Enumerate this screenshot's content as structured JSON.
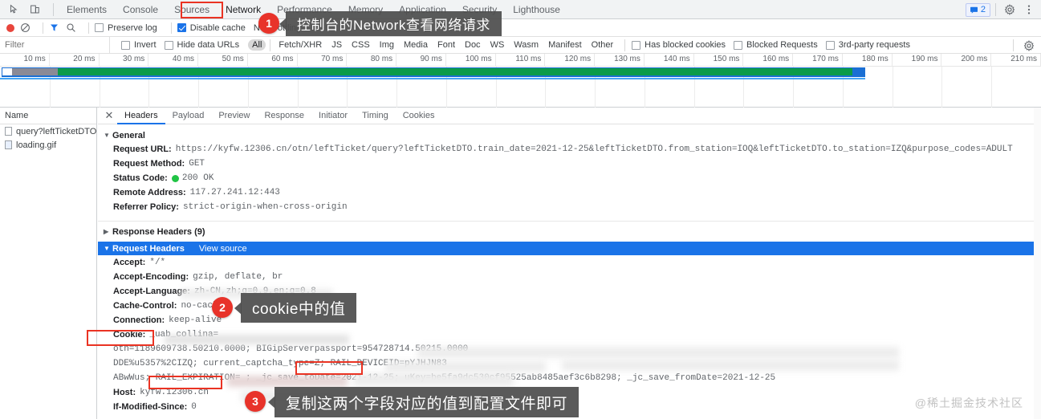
{
  "devtools": {
    "tabs": [
      {
        "label": "Elements",
        "selected": false
      },
      {
        "label": "Console",
        "selected": false
      },
      {
        "label": "Sources",
        "selected": false
      },
      {
        "label": "Network",
        "selected": true,
        "highlighted": true
      },
      {
        "label": "Performance",
        "selected": false
      },
      {
        "label": "Memory",
        "selected": false
      },
      {
        "label": "Application",
        "selected": false
      },
      {
        "label": "Security",
        "selected": false
      },
      {
        "label": "Lighthouse",
        "selected": false
      }
    ],
    "issues_count": "2",
    "icons": {
      "inspect": "inspect-element-icon",
      "device": "device-toolbar-icon",
      "issues": "issues-icon",
      "settings": "gear-icon",
      "more": "more-vertical-icon"
    }
  },
  "network_toolbar": {
    "record_label": "record-button",
    "clear_label": "clear-button",
    "filter_icon": "funnel-icon",
    "search_icon": "search-icon",
    "preserve_log": {
      "label": "Preserve log",
      "checked": false
    },
    "disable_cache": {
      "label": "Disable cache",
      "checked": true
    },
    "throttling": "No throttling"
  },
  "filter_row": {
    "placeholder": "Filter",
    "invert": {
      "label": "Invert",
      "checked": false
    },
    "hide_data_urls": {
      "label": "Hide data URLs",
      "checked": false
    },
    "types": [
      {
        "label": "All",
        "active": true
      },
      {
        "label": "Fetch/XHR",
        "active": false
      },
      {
        "label": "JS",
        "active": false
      },
      {
        "label": "CSS",
        "active": false
      },
      {
        "label": "Img",
        "active": false
      },
      {
        "label": "Media",
        "active": false
      },
      {
        "label": "Font",
        "active": false
      },
      {
        "label": "Doc",
        "active": false
      },
      {
        "label": "WS",
        "active": false
      },
      {
        "label": "Wasm",
        "active": false
      },
      {
        "label": "Manifest",
        "active": false
      },
      {
        "label": "Other",
        "active": false
      }
    ],
    "has_blocked_cookies": {
      "label": "Has blocked cookies",
      "checked": false
    },
    "blocked_requests": {
      "label": "Blocked Requests",
      "checked": false
    },
    "third_party": {
      "label": "3rd-party requests",
      "checked": false
    },
    "settings_icon": "gear-icon"
  },
  "overview": {
    "ticks": [
      "10 ms",
      "20 ms",
      "30 ms",
      "40 ms",
      "50 ms",
      "60 ms",
      "70 ms",
      "80 ms",
      "90 ms",
      "100 ms",
      "110 ms",
      "120 ms",
      "130 ms",
      "140 ms",
      "150 ms",
      "160 ms",
      "170 ms",
      "180 ms",
      "190 ms",
      "200 ms",
      "210 ms"
    ]
  },
  "request_list": {
    "header": "Name",
    "rows": [
      {
        "name": "query?leftTicketDTO....",
        "type": "doc",
        "selected": true
      },
      {
        "name": "loading.gif",
        "type": "img",
        "selected": false
      }
    ]
  },
  "detail_tabs": [
    {
      "label": "Headers",
      "selected": true
    },
    {
      "label": "Payload",
      "selected": false
    },
    {
      "label": "Preview",
      "selected": false
    },
    {
      "label": "Response",
      "selected": false
    },
    {
      "label": "Initiator",
      "selected": false
    },
    {
      "label": "Timing",
      "selected": false
    },
    {
      "label": "Cookies",
      "selected": false
    }
  ],
  "headers": {
    "general_section": "General",
    "general_rows": [
      {
        "name": "Request URL:",
        "value": "https://kyfw.12306.cn/otn/leftTicket/query?leftTicketDTO.train_date=2021-12-25&leftTicketDTO.from_station=IOQ&leftTicketDTO.to_station=IZQ&purpose_codes=ADULT"
      },
      {
        "name": "Request Method:",
        "value": "GET"
      },
      {
        "name": "Status Code:",
        "value": "200  OK",
        "has_status_dot": true
      },
      {
        "name": "Remote Address:",
        "value": "117.27.241.12:443"
      },
      {
        "name": "Referrer Policy:",
        "value": "strict-origin-when-cross-origin"
      }
    ],
    "response_section": "Response Headers (9)",
    "request_section": "Request Headers",
    "view_source": "View source",
    "request_rows": [
      {
        "name": "Accept:",
        "value": "*/*"
      },
      {
        "name": "Accept-Encoding:",
        "value": "gzip, deflate, br"
      },
      {
        "name": "Accept-Language:",
        "value": "zh-CN,zh;q=0.9,en;q=0.8"
      },
      {
        "name": "Cache-Control:",
        "value": "no-cache"
      },
      {
        "name": "Connection:",
        "value": "keep-alive"
      },
      {
        "name": "Cookie:",
        "value": "_uab_collina="
      }
    ],
    "cookie_continuation": [
      "otn=1189609738.50210.0000; BIGipServerpassport=954728714.50215.0000",
      "DDE%u5357%2CIZQ; current_captcha_type=Z; RAIL_DEVICEID=pYJHJN83",
      "ABwWus; RAIL_EXPIRATION=                    ; _jc_save_toDate=2021-12-25; uKey=be5fa9dc530cf95525ab8485aef3c6b8298; _jc_save_fromDate=2021-12-25"
    ],
    "tail_rows": [
      {
        "name": "Host:",
        "value": "kyfw.12306.cn"
      },
      {
        "name": "If-Modified-Since:",
        "value": "0"
      }
    ]
  },
  "annotations": [
    {
      "number": "1",
      "text": "控制台的Network查看网络请求"
    },
    {
      "number": "2",
      "text": "cookie中的值"
    },
    {
      "number": "3",
      "text": "复制这两个字段对应的值到配置文件即可"
    }
  ],
  "watermark": "@稀土掘金技术社区",
  "colors": {
    "accent": "#1a73e8",
    "annotation_red": "#e8332a",
    "highlight_box": "#ea3323",
    "status_ok": "#21c445",
    "bar_green": "#0b9b4a",
    "bar_blue": "#1a6fd4"
  }
}
